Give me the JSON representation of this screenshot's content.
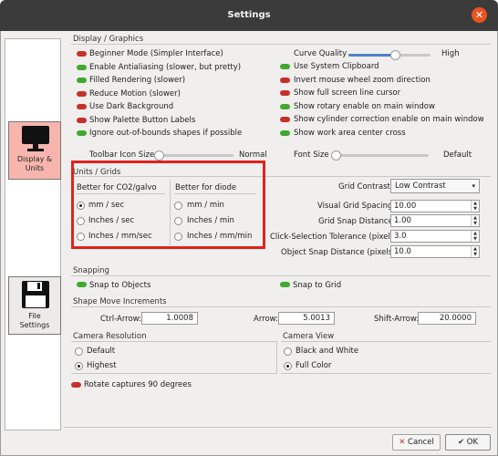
{
  "window": {
    "title": "Settings"
  },
  "sidebar": {
    "display_label": "Display &\nUnits",
    "file_label": "File\nSettings"
  },
  "display": {
    "heading": "Display / Graphics",
    "left_checks": [
      {
        "label": "Beginner Mode (Simpler Interface)",
        "on": false
      },
      {
        "label": "Enable Antialiasing (slower, but pretty)",
        "on": true
      },
      {
        "label": "Filled Rendering (slower)",
        "on": true
      },
      {
        "label": "Reduce Motion (slower)",
        "on": false
      },
      {
        "label": "Use Dark Background",
        "on": false
      },
      {
        "label": "Show Palette Button Labels",
        "on": false
      },
      {
        "label": "Ignore out-of-bounds shapes if possible",
        "on": true
      }
    ],
    "curve_quality": {
      "label": "Curve Quality",
      "value": "High"
    },
    "right_checks": [
      {
        "label": "Use System Clipboard",
        "on": true
      },
      {
        "label": "Invert mouse wheel zoom direction",
        "on": false
      },
      {
        "label": "Show full screen line cursor",
        "on": false
      },
      {
        "label": "Show rotary enable on main window",
        "on": true
      },
      {
        "label": "Show cylinder correction enable on main window",
        "on": false
      },
      {
        "label": "Show work area center cross",
        "on": true
      }
    ],
    "toolbar_icon_size": {
      "label": "Toolbar Icon Size",
      "value": "Normal"
    },
    "font_size": {
      "label": "Font Size",
      "value": "Default"
    }
  },
  "units": {
    "heading": "Units / Grids",
    "co2_heading": "Better for CO2/galvo",
    "co2_options": [
      "mm / sec",
      "Inches / sec",
      "Inches / mm/sec"
    ],
    "diode_heading": "Better for diode",
    "diode_options": [
      "mm / min",
      "Inches / min",
      "Inches / mm/min"
    ],
    "grid_contrast": {
      "label": "Grid Contrast",
      "value": "Low Contrast"
    },
    "visual_grid_spacing": {
      "label": "Visual Grid Spacing",
      "value": "10.00"
    },
    "grid_snap_distance": {
      "label": "Grid Snap Distance",
      "value": "1.00"
    },
    "click_tolerance": {
      "label": "Click-Selection Tolerance (pixels)",
      "value": "3.0"
    },
    "object_snap": {
      "label": "Object Snap Distance (pixels)",
      "value": "10.0"
    }
  },
  "snapping": {
    "heading": "Snapping",
    "objects": "Snap to Objects",
    "grid": "Snap to Grid"
  },
  "shape_move": {
    "heading": "Shape Move Increments",
    "ctrl": {
      "label": "Ctrl-Arrow:",
      "value": "1.0008"
    },
    "arrow": {
      "label": "Arrow:",
      "value": "5.0013"
    },
    "shift": {
      "label": "Shift-Arrow:",
      "value": "20.0000"
    }
  },
  "camera_resolution": {
    "heading": "Camera Resolution",
    "options": [
      "Default",
      "Highest"
    ]
  },
  "camera_view": {
    "heading": "Camera View",
    "options": [
      "Black and White",
      "Full Color"
    ]
  },
  "rotate_captures": "Rotate captures 90 degrees",
  "footer": {
    "cancel": "Cancel",
    "ok": "OK"
  },
  "colors": {
    "highlight": "#e0221c",
    "titlebar": "#3b3b3b",
    "close": "#e95420",
    "toggle_on": "#3faa2e",
    "toggle_off": "#c6302b"
  }
}
